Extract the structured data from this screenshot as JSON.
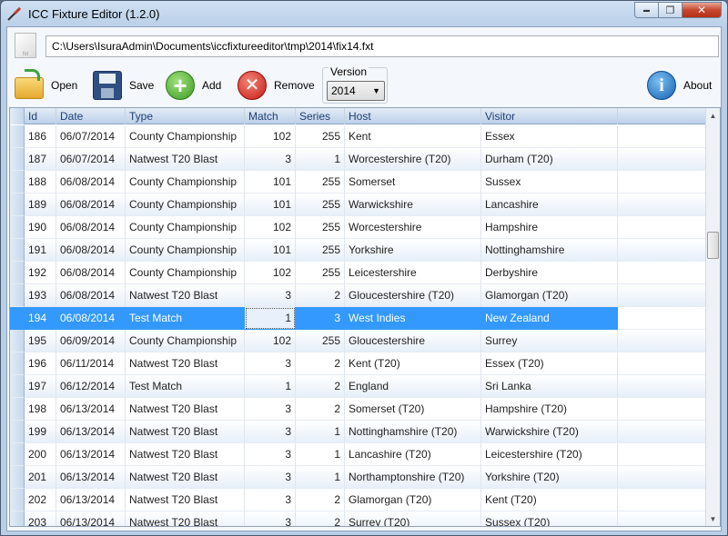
{
  "window": {
    "title": "ICC Fixture Editor (1.2.0)",
    "controls": {
      "minimize": "▬",
      "maximize": "❐",
      "close": "✕"
    }
  },
  "path": {
    "value": "C:\\Users\\IsuraAdmin\\Documents\\iccfixtureeditor\\tmp\\2014\\fix14.fxt",
    "file_icon_text": "fxt"
  },
  "toolbar": {
    "open_label": "Open",
    "save_label": "Save",
    "add_label": "Add",
    "remove_label": "Remove",
    "about_label": "About",
    "version": {
      "legend": "Version",
      "selected": "2014"
    }
  },
  "icons": {
    "open": "folder-open-icon",
    "save": "floppy-disk-icon",
    "add": "plus-icon",
    "remove": "x-icon",
    "about": "info-icon"
  },
  "colors": {
    "selection": "#3399ff",
    "header_text": "#1f3f73"
  },
  "grid": {
    "columns": [
      "Id",
      "Date",
      "Type",
      "Match",
      "Series",
      "Host",
      "Visitor"
    ],
    "selected_id": "194",
    "rows": [
      {
        "id": "186",
        "date": "06/07/2014",
        "type": "County Championship",
        "match": "102",
        "series": "255",
        "host": "Kent",
        "visitor": "Essex"
      },
      {
        "id": "187",
        "date": "06/07/2014",
        "type": "Natwest T20 Blast",
        "match": "3",
        "series": "1",
        "host": "Worcestershire (T20)",
        "visitor": "Durham (T20)"
      },
      {
        "id": "188",
        "date": "06/08/2014",
        "type": "County Championship",
        "match": "101",
        "series": "255",
        "host": "Somerset",
        "visitor": "Sussex"
      },
      {
        "id": "189",
        "date": "06/08/2014",
        "type": "County Championship",
        "match": "101",
        "series": "255",
        "host": "Warwickshire",
        "visitor": "Lancashire"
      },
      {
        "id": "190",
        "date": "06/08/2014",
        "type": "County Championship",
        "match": "102",
        "series": "255",
        "host": "Worcestershire",
        "visitor": "Hampshire"
      },
      {
        "id": "191",
        "date": "06/08/2014",
        "type": "County Championship",
        "match": "101",
        "series": "255",
        "host": "Yorkshire",
        "visitor": "Nottinghamshire"
      },
      {
        "id": "192",
        "date": "06/08/2014",
        "type": "County Championship",
        "match": "102",
        "series": "255",
        "host": "Leicestershire",
        "visitor": "Derbyshire"
      },
      {
        "id": "193",
        "date": "06/08/2014",
        "type": "Natwest T20 Blast",
        "match": "3",
        "series": "2",
        "host": "Gloucestershire (T20)",
        "visitor": "Glamorgan (T20)"
      },
      {
        "id": "194",
        "date": "06/08/2014",
        "type": "Test Match",
        "match": "1",
        "series": "3",
        "host": "West Indies",
        "visitor": "New Zealand"
      },
      {
        "id": "195",
        "date": "06/09/2014",
        "type": "County Championship",
        "match": "102",
        "series": "255",
        "host": "Gloucestershire",
        "visitor": "Surrey"
      },
      {
        "id": "196",
        "date": "06/11/2014",
        "type": "Natwest T20 Blast",
        "match": "3",
        "series": "2",
        "host": "Kent (T20)",
        "visitor": "Essex (T20)"
      },
      {
        "id": "197",
        "date": "06/12/2014",
        "type": "Test Match",
        "match": "1",
        "series": "2",
        "host": "England",
        "visitor": "Sri Lanka"
      },
      {
        "id": "198",
        "date": "06/13/2014",
        "type": "Natwest T20 Blast",
        "match": "3",
        "series": "2",
        "host": "Somerset (T20)",
        "visitor": "Hampshire (T20)"
      },
      {
        "id": "199",
        "date": "06/13/2014",
        "type": "Natwest T20 Blast",
        "match": "3",
        "series": "1",
        "host": "Nottinghamshire (T20)",
        "visitor": "Warwickshire (T20)"
      },
      {
        "id": "200",
        "date": "06/13/2014",
        "type": "Natwest T20 Blast",
        "match": "3",
        "series": "1",
        "host": "Lancashire (T20)",
        "visitor": "Leicestershire (T20)"
      },
      {
        "id": "201",
        "date": "06/13/2014",
        "type": "Natwest T20 Blast",
        "match": "3",
        "series": "1",
        "host": "Northamptonshire (T20)",
        "visitor": "Yorkshire (T20)"
      },
      {
        "id": "202",
        "date": "06/13/2014",
        "type": "Natwest T20 Blast",
        "match": "3",
        "series": "2",
        "host": "Glamorgan (T20)",
        "visitor": "Kent (T20)"
      },
      {
        "id": "203",
        "date": "06/13/2014",
        "type": "Natwest T20 Blast",
        "match": "3",
        "series": "2",
        "host": "Surrey (T20)",
        "visitor": "Sussex (T20)"
      }
    ]
  }
}
